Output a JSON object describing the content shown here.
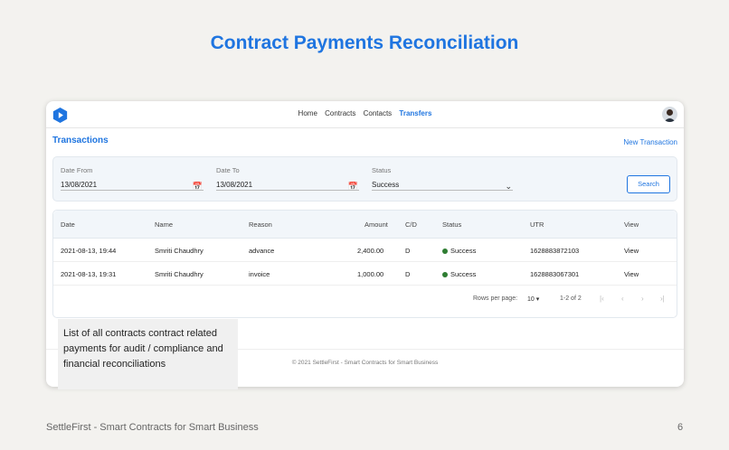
{
  "slide": {
    "title": "Contract Payments Reconciliation",
    "footer_text": "SettleFirst - Smart Contracts for Smart Business",
    "page_number": "6",
    "callout": "List of all contracts contract related payments for audit / compliance and financial reconciliations"
  },
  "app": {
    "nav": [
      "Home",
      "Contracts",
      "Contacts",
      "Transfers"
    ],
    "active_nav": "Transfers",
    "section_title": "Transactions",
    "new_transaction": "New Transaction",
    "filters": {
      "date_from_label": "Date From",
      "date_from_value": "13/08/2021",
      "date_to_label": "Date To",
      "date_to_value": "13/08/2021",
      "status_label": "Status",
      "status_value": "Success",
      "search_label": "Search"
    },
    "table": {
      "headers": {
        "date": "Date",
        "name": "Name",
        "reason": "Reason",
        "amount": "Amount",
        "cd": "C/D",
        "status": "Status",
        "utr": "UTR",
        "view": "View"
      },
      "rows": [
        {
          "date": "2021-08-13, 19:44",
          "name": "Smriti Chaudhry",
          "reason": "advance",
          "amount": "2,400.00",
          "cd": "D",
          "status": "Success",
          "utr": "1628883872103",
          "view": "View"
        },
        {
          "date": "2021-08-13, 19:31",
          "name": "Smriti Chaudhry",
          "reason": "invoice",
          "amount": "1,000.00",
          "cd": "D",
          "status": "Success",
          "utr": "1628883067301",
          "view": "View"
        }
      ],
      "rows_per_page_label": "Rows per page:",
      "rows_per_page_value": "10",
      "range_text": "1-2 of 2"
    },
    "footer": "© 2021 SettleFirst - Smart Contracts for Smart Business",
    "colors": {
      "accent": "#1f75e0",
      "success": "#2e7d32"
    }
  }
}
